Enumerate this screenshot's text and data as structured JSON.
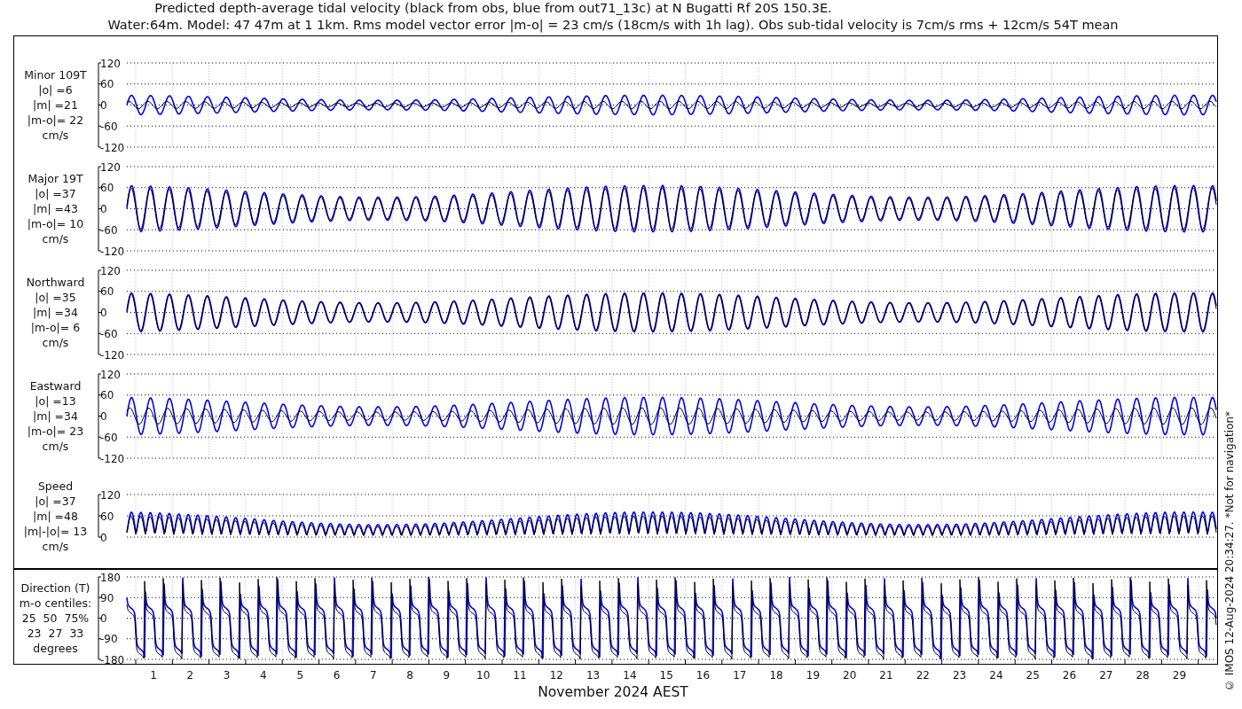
{
  "title": [
    "Predicted depth-average tidal velocity (black from obs, blue from out71_13c) at N Bugatti Rf 20S 150.3E.",
    "Water:64m. Model: 47 47m at 1 1km. Rms model vector error |m-o| = 23 cm/s (18cm/s with 1h lag). Obs sub-tidal velocity is 7cm/s rms + 12cm/s 54T mean"
  ],
  "panels": [
    {
      "kind": "minor",
      "label": "Minor 109T\n|o| =6\n|m| =21\n|m-o|= 22\ncm/s",
      "yticks": [
        "120",
        "60",
        "0",
        "-60",
        "-120"
      ]
    },
    {
      "kind": "major",
      "label": "Major 19T\n|o| =37\n|m| =43\n|m-o|= 10\ncm/s",
      "yticks": [
        "120",
        "60",
        "0",
        "-60",
        "-120"
      ]
    },
    {
      "kind": "north",
      "label": "Northward\n|o| =35\n|m| =34\n|m-o|= 6\ncm/s",
      "yticks": [
        "120",
        "60",
        "0",
        "-60",
        "-120"
      ]
    },
    {
      "kind": "east",
      "label": "Eastward\n|o| =13\n|m| =34\n|m-o|= 23\ncm/s",
      "yticks": [
        "120",
        "60",
        "0",
        "-60",
        "-120"
      ]
    },
    {
      "kind": "speed",
      "label": "Speed\n|o| =37\n|m| =48\n|m|-|o|= 13\ncm/s",
      "yticks": [
        "120",
        "60",
        "0"
      ]
    },
    {
      "kind": "direction",
      "label": "Direction (T)\nm-o centiles:\n25  50  75%\n23  27  33\ndegrees",
      "yticks": [
        "180",
        "90",
        "0",
        "-90",
        "-180"
      ]
    }
  ],
  "xticks": [
    "1",
    "2",
    "3",
    "4",
    "5",
    "6",
    "7",
    "8",
    "9",
    "10",
    "11",
    "12",
    "13",
    "14",
    "15",
    "16",
    "17",
    "18",
    "19",
    "20",
    "21",
    "22",
    "23",
    "24",
    "25",
    "26",
    "27",
    "28",
    "29"
  ],
  "xlabel": "November 2024 AEST",
  "copyright": "© IMOS 12-Aug-2024 20:34:27. *Not for navigation*"
}
